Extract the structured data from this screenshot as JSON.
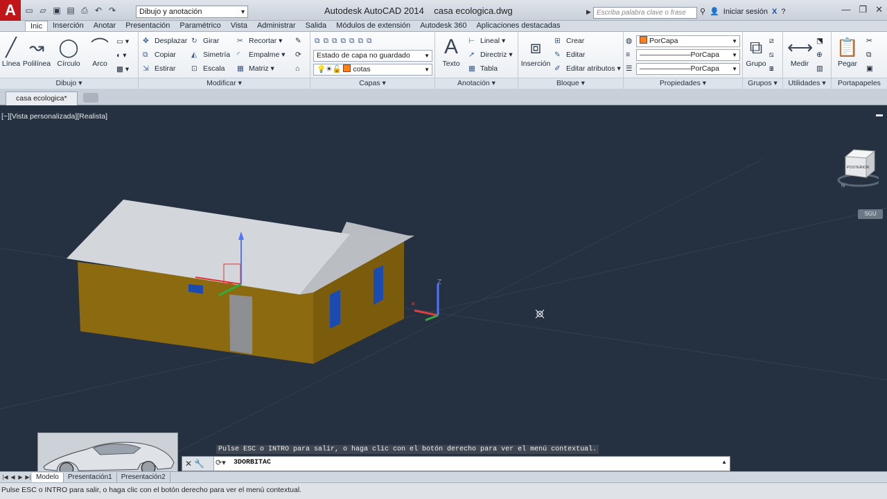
{
  "app": {
    "logo_letter": "A",
    "title": "Autodesk AutoCAD 2014",
    "filename": "casa ecologica.dwg",
    "workspace": "Dibujo y anotación",
    "search_placeholder": "Escriba palabra clave o frase",
    "signin": "Iniciar sesión"
  },
  "tabs": [
    "Inic",
    "Inserción",
    "Anotar",
    "Presentación",
    "Paramétrico",
    "Vista",
    "Administrar",
    "Salida",
    "Módulos de extensión",
    "Autodesk 360",
    "Aplicaciones destacadas"
  ],
  "ribbon": {
    "dibujo": {
      "title": "Dibujo",
      "linea": "Línea",
      "polilinea": "Polilínea",
      "circulo": "Círculo",
      "arco": "Arco"
    },
    "modificar": {
      "title": "Modificar",
      "desplazar": "Desplazar",
      "girar": "Girar",
      "recortar": "Recortar",
      "copiar": "Copiar",
      "simetria": "Simetría",
      "empalme": "Empalme",
      "estirar": "Estirar",
      "escala": "Escala",
      "matriz": "Matriz"
    },
    "capas": {
      "title": "Capas",
      "estado": "Estado de capa no guardado",
      "capa": "cotas"
    },
    "anotacion": {
      "title": "Anotación",
      "texto": "Texto",
      "lineal": "Lineal",
      "directriz": "Directriz",
      "tabla": "Tabla"
    },
    "bloque": {
      "title": "Bloque",
      "insercion": "Inserción",
      "crear": "Crear",
      "editar": "Editar",
      "editar_atributos": "Editar atributos"
    },
    "propiedades": {
      "title": "Propiedades",
      "color": "PorCapa",
      "tipo_linea": "PorCapa",
      "grosor": "PorCapa"
    },
    "grupos": {
      "title": "Grupos",
      "grupo": "Grupo"
    },
    "utilidades": {
      "title": "Utilidades",
      "medir": "Medir"
    },
    "portapapeles": {
      "title": "Portapapeles",
      "pegar": "Pegar"
    }
  },
  "document_tab": "casa ecologica*",
  "viewport": {
    "label": "[−][Vista personalizada][Realista]",
    "viewcube_face": "POSTERIOR",
    "wcs": "SGU",
    "axis_z": "Z"
  },
  "command": {
    "history": "Pulse ESC o INTRO para salir, o haga clic con el botón derecho para ver el menú contextual.",
    "input": "3DORBITAC"
  },
  "layout_tabs": [
    "Modelo",
    "Presentación1",
    "Presentación2"
  ],
  "status_text": "Pulse ESC o INTRO para salir, o haga clic con el botón derecho para ver el menú contextual.",
  "colors": {
    "wall": "#8c6a10",
    "roof": "#c9cdd1",
    "door": "#8d8f92",
    "window": "#1b4bb0",
    "background": "#253040"
  }
}
